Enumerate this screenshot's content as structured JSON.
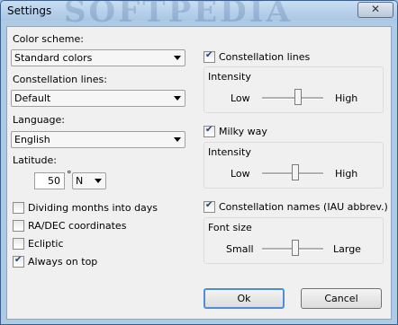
{
  "window": {
    "title": "Settings",
    "watermark": "SOFTPEDIA",
    "close_glyph": "✕"
  },
  "left": {
    "color_scheme": {
      "label": "Color scheme:",
      "value": "Standard colors"
    },
    "constellation_lines": {
      "label": "Constellation lines:",
      "value": "Default"
    },
    "language": {
      "label": "Language:",
      "value": "English"
    },
    "latitude": {
      "label": "Latitude:",
      "value": "50",
      "degree": "°",
      "direction": "N"
    },
    "checkboxes": [
      {
        "label": "Dividing months into days",
        "checked": false
      },
      {
        "label": "RA/DEC coordinates",
        "checked": false
      },
      {
        "label": "Ecliptic",
        "checked": false
      },
      {
        "label": "Always on top",
        "checked": true
      }
    ]
  },
  "right": {
    "constellation_lines": {
      "label": "Constellation lines",
      "checked": true,
      "group_title": "Intensity",
      "low": "Low",
      "high": "High",
      "level": 0.6
    },
    "milky_way": {
      "label": "Milky way",
      "checked": true,
      "group_title": "Intensity",
      "low": "Low",
      "high": "High",
      "level": 0.55
    },
    "constellation_names": {
      "label": "Constellation names (IAU abbrev.)",
      "checked": true,
      "group_title": "Font size",
      "low": "Small",
      "high": "Large",
      "level": 0.55
    }
  },
  "buttons": {
    "ok": "Ok",
    "cancel": "Cancel"
  }
}
